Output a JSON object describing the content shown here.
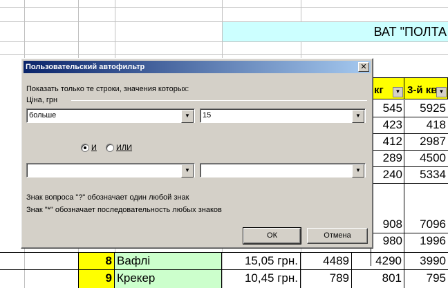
{
  "sheet": {
    "title": "ВАТ \"ПОЛТА",
    "col_headers": [
      "кг",
      "3-й кв"
    ],
    "col_d_values": [
      "545",
      "423",
      "412",
      "289",
      "240",
      "",
      "908",
      "980"
    ],
    "col_e_values": [
      "5925",
      "418",
      "2987",
      "4500",
      "5334",
      "",
      "7096",
      "1996"
    ],
    "rows": [
      {
        "num": "8",
        "name": "Вафлі",
        "price": "15,05 грн.",
        "v1": "4489",
        "v2": "4290",
        "v3": "3990"
      },
      {
        "num": "9",
        "name": "Крекер",
        "price": "10,45 грн.",
        "v1": "789",
        "v2": "801",
        "v3": "795"
      }
    ]
  },
  "dialog": {
    "title": "Пользовательский автофильтр",
    "close": "✕",
    "prompt": "Показать только те строки, значения которых:",
    "field_label": "Ціна, грн",
    "op1": "больше",
    "val1": "15",
    "radio_and": "И",
    "radio_or": "ИЛИ",
    "op2": "",
    "val2": "",
    "hint1": "Знак вопроса \"?\" обозначает один любой знак",
    "hint2": "Знак \"*\" обозначает последовательность любых знаков",
    "ok": "ОК",
    "cancel": "Отмена"
  }
}
